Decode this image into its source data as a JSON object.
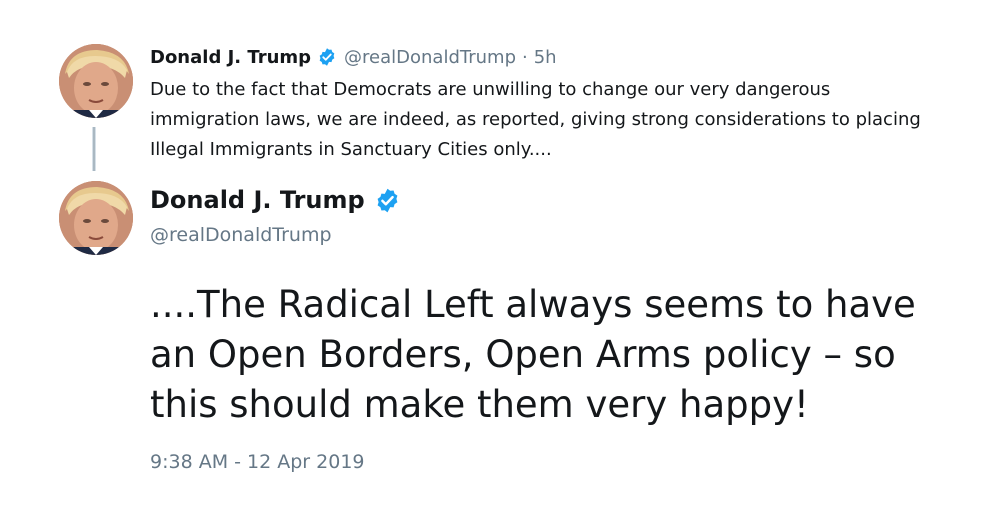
{
  "parent_tweet": {
    "author_name": "Donald J. Trump",
    "handle": "@realDonaldTrump",
    "separator": "·",
    "age": "5h",
    "text": "Due to the fact that Democrats are unwilling to change our very dangerous immigration laws, we are indeed, as reported, giving strong considerations to placing Illegal Immigrants in Sanctuary Cities only....",
    "avatar_icon": "profile-photo",
    "verified_icon": "verified-badge-icon"
  },
  "main_tweet": {
    "author_name": "Donald J. Trump",
    "handle": "@realDonaldTrump",
    "text": "....The Radical Left always seems to have an Open Borders, Open Arms policy – so this should make them very happy!",
    "timestamp": "9:38 AM - 12 Apr 2019",
    "avatar_icon": "profile-photo",
    "verified_icon": "verified-badge-icon"
  },
  "colors": {
    "verified_blue": "#1da1f2",
    "secondary_text": "#657786",
    "primary_text": "#14171a",
    "thread_line": "#aab8c2"
  }
}
